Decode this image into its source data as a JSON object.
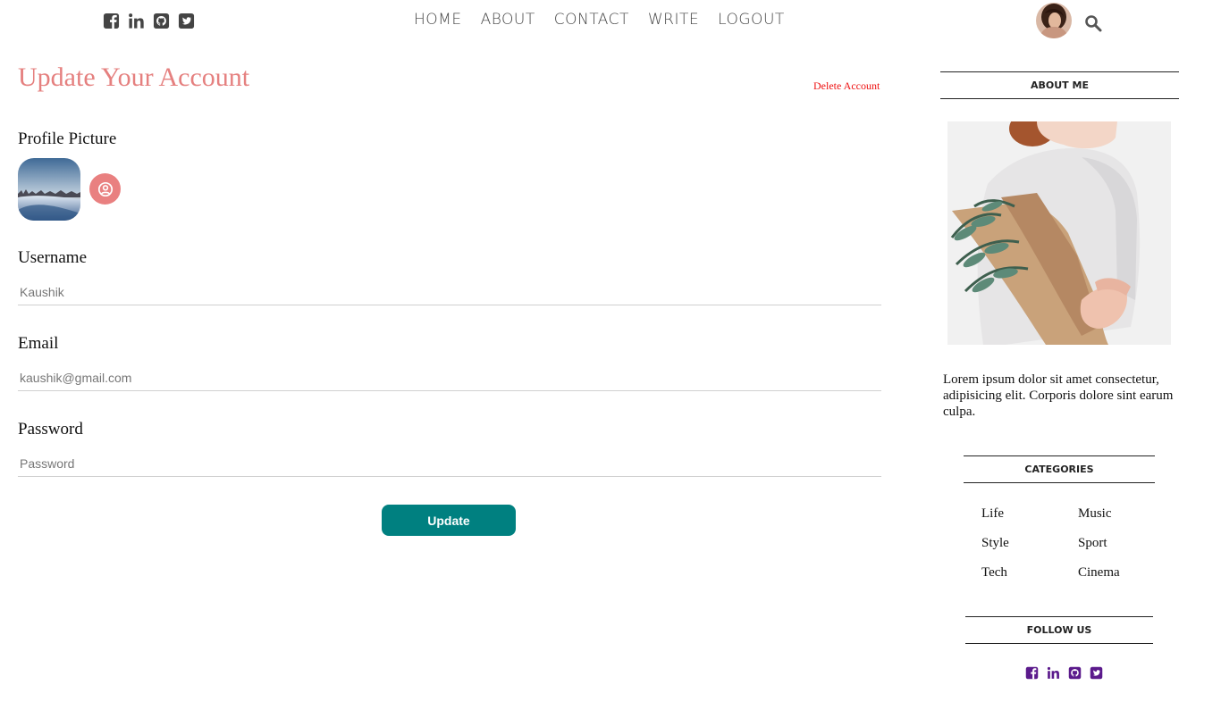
{
  "header": {
    "social_icons": [
      "facebook-square-icon",
      "linkedin-icon",
      "github-square-icon",
      "twitter-square-icon"
    ],
    "nav": [
      {
        "label": "HOME"
      },
      {
        "label": "ABOUT"
      },
      {
        "label": "CONTACT"
      },
      {
        "label": "WRITE"
      },
      {
        "label": "LOGOUT"
      }
    ],
    "search_icon": "search-icon"
  },
  "main": {
    "title": "Update Your Account",
    "delete_label": "Delete Account",
    "profile_picture_label": "Profile Picture",
    "profile_button_icon": "user-circle-icon",
    "username": {
      "label": "Username",
      "placeholder": "Kaushik"
    },
    "email": {
      "label": "Email",
      "placeholder": "kaushik@gmail.com"
    },
    "password": {
      "label": "Password",
      "placeholder": "Password"
    },
    "update_label": "Update"
  },
  "sidebar": {
    "about_title": "ABOUT ME",
    "about_text": "Lorem ipsum dolor sit amet consectetur, adipisicing elit. Corporis dolore sint earum culpa.",
    "categories_title": "CATEGORIES",
    "categories": [
      {
        "label": "Life"
      },
      {
        "label": "Music"
      },
      {
        "label": "Style"
      },
      {
        "label": "Sport"
      },
      {
        "label": "Tech"
      },
      {
        "label": "Cinema"
      }
    ],
    "follow_title": "FOLLOW US",
    "follow_icons": [
      "facebook-square-icon",
      "linkedin-icon",
      "github-square-icon",
      "twitter-square-icon"
    ]
  },
  "colors": {
    "title": "#e5807f",
    "delete_link": "#ee1111",
    "profile_button": "#e98080",
    "update_button": "#008080",
    "top_icons": "#444444",
    "follow_icons": "#5b1a8c"
  }
}
